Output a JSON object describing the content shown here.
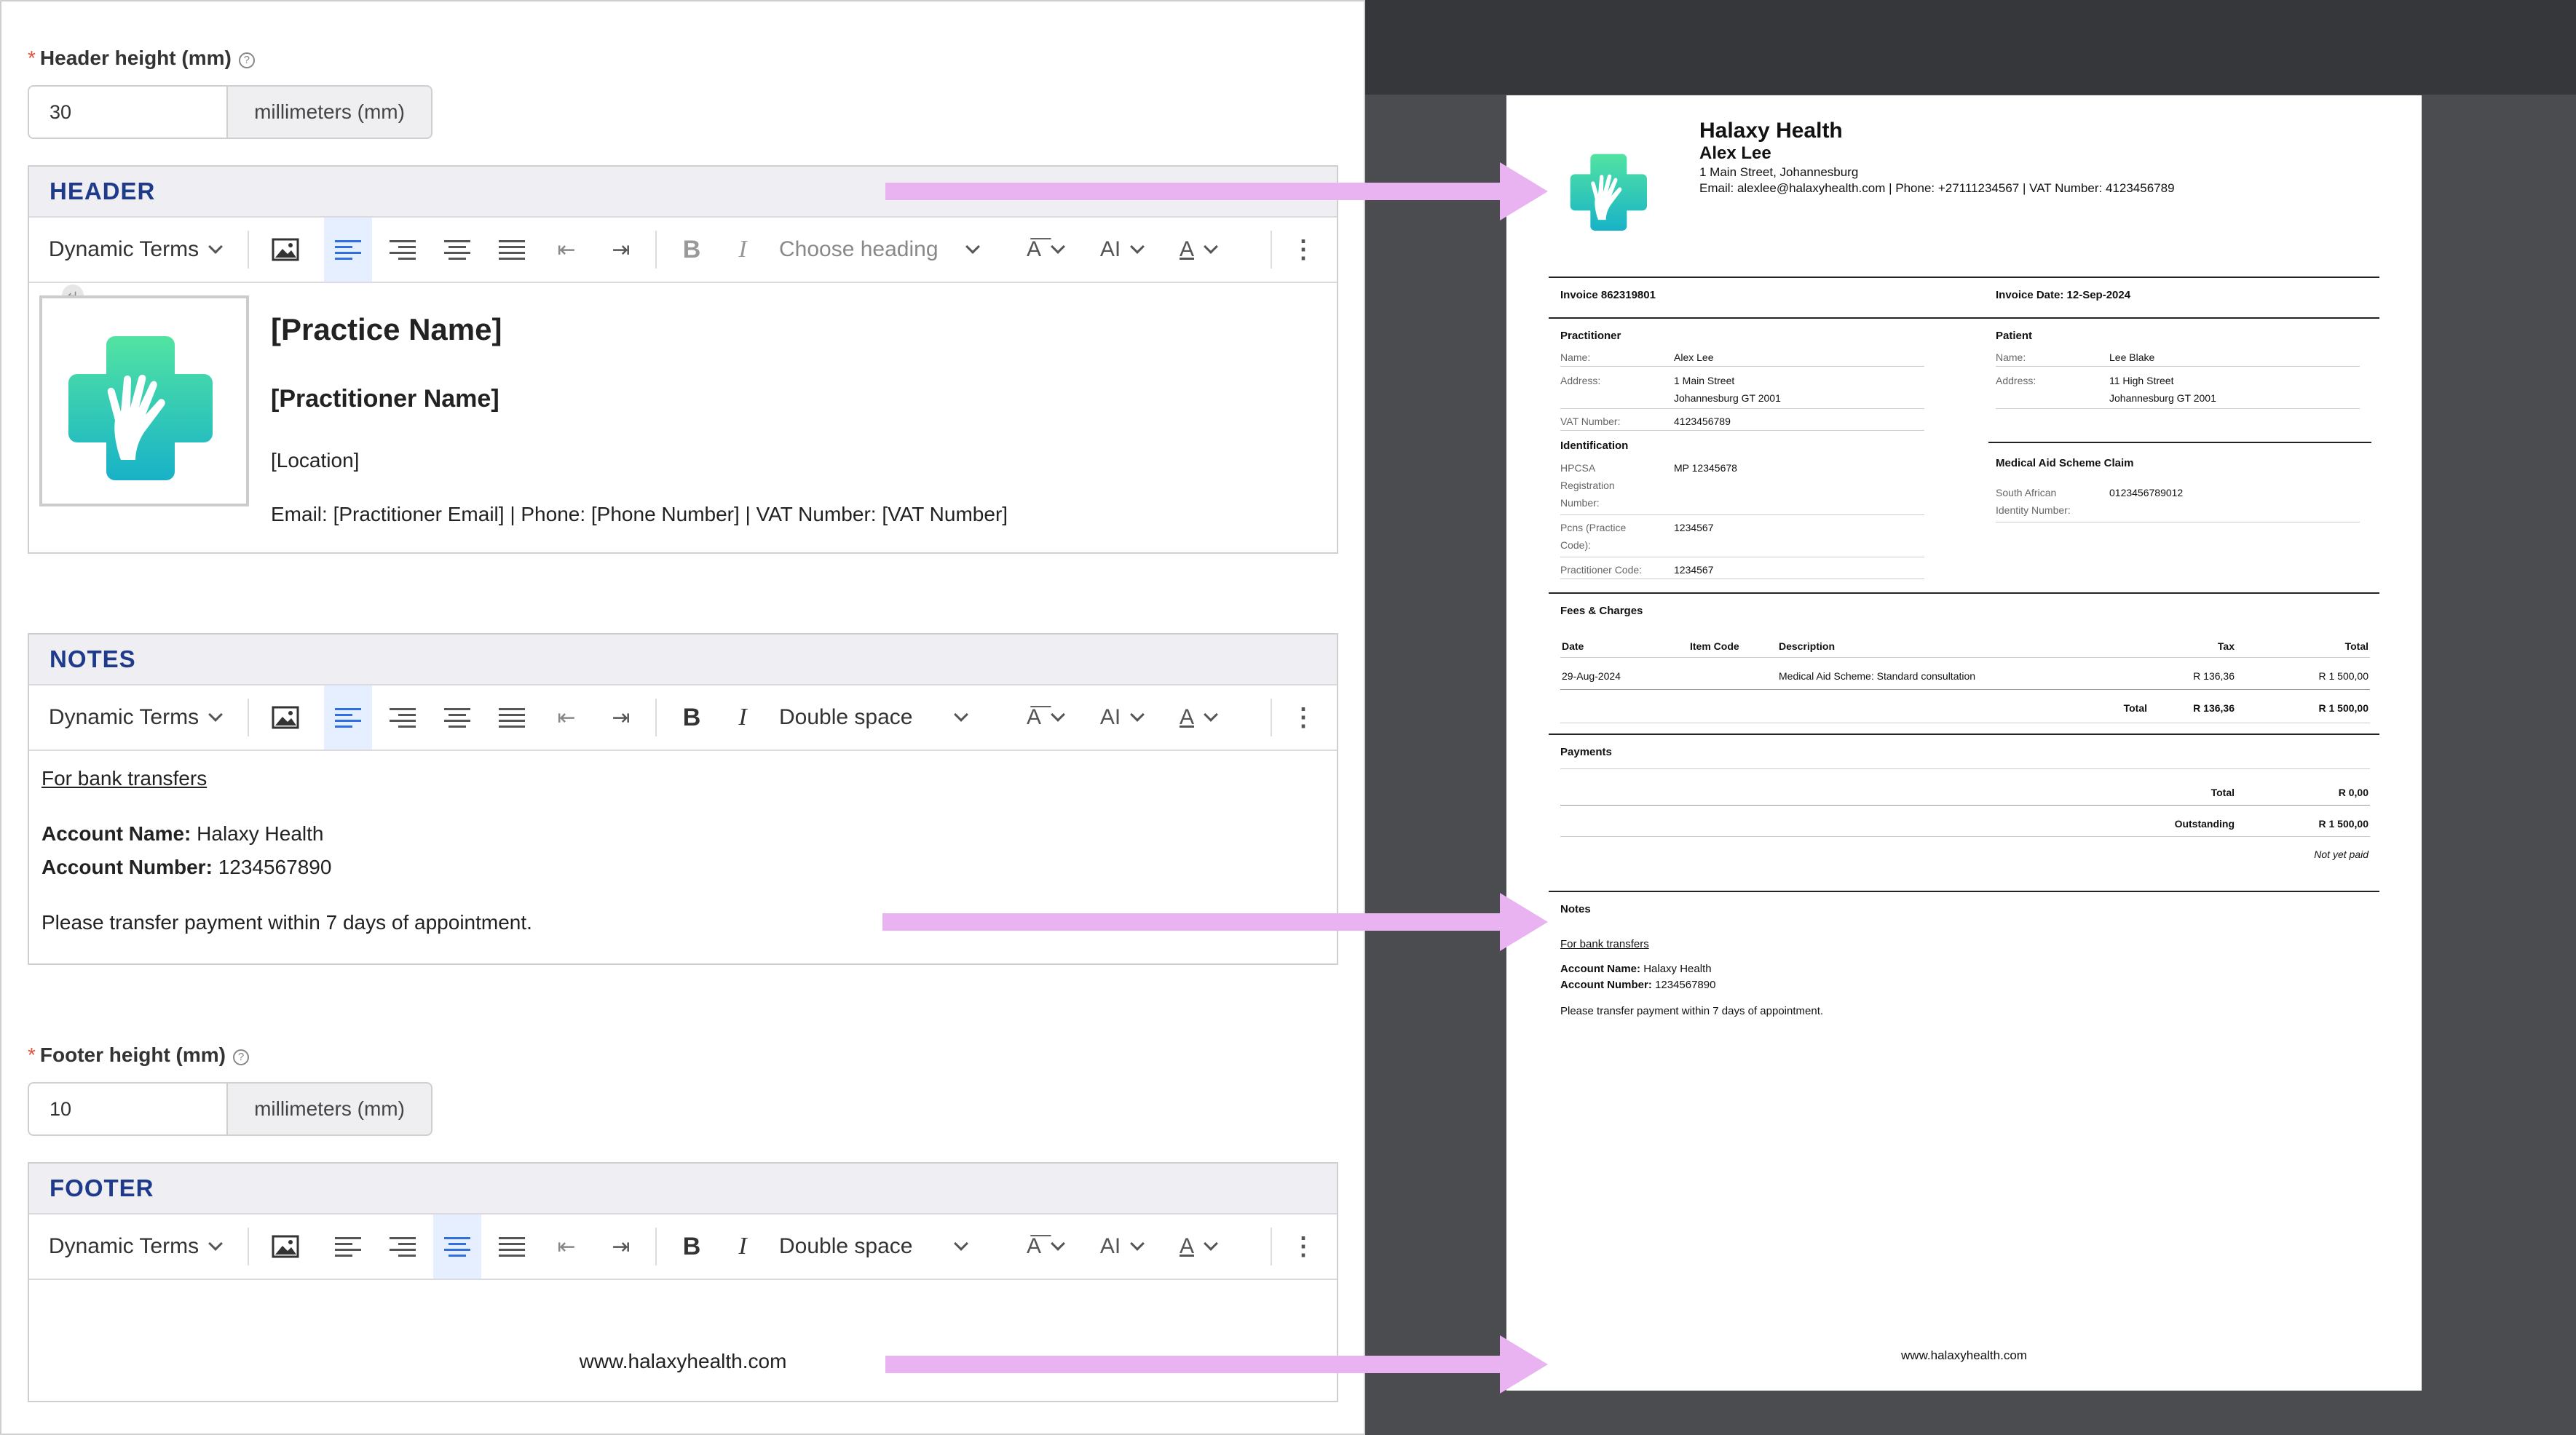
{
  "editor": {
    "header_height": {
      "label": "Header height (mm)",
      "value": "30",
      "unit": "millimeters (mm)"
    },
    "footer_height": {
      "label": "Footer height (mm)",
      "value": "10",
      "unit": "millimeters (mm)"
    },
    "toolbar": {
      "dynamic_terms": "Dynamic Terms",
      "choose_heading": "Choose heading",
      "double_space": "Double space"
    },
    "header": {
      "title": "HEADER",
      "practice_name": "[Practice Name]",
      "practitioner_name": "[Practitioner Name]",
      "location": "[Location]",
      "contact_line": "Email: [Practitioner Email] | Phone: [Phone Number] | VAT Number: [VAT Number]"
    },
    "notes": {
      "title": "NOTES",
      "bank_heading": "For bank transfers",
      "account_name_label": "Account Name:",
      "account_name": "Halaxy Health",
      "account_number_label": "Account Number:",
      "account_number": "1234567890",
      "instruction": "Please transfer payment within 7 days of appointment."
    },
    "footer": {
      "title": "FOOTER",
      "url": "www.halaxyhealth.com"
    }
  },
  "invoice": {
    "practice_name": "Halaxy Health",
    "practitioner": "Alex Lee",
    "address": "1 Main Street, Johannesburg",
    "contact": "Email: alexlee@halaxyhealth.com | Phone: +27111234567 | VAT Number: 4123456789",
    "invoice_no": "Invoice 862319801",
    "invoice_date": "Invoice Date: 12-Sep-2024",
    "practitioner_section": {
      "title": "Practitioner",
      "name_label": "Name:",
      "name": "Alex Lee",
      "address_label": "Address:",
      "address1": "1 Main Street",
      "address2": "Johannesburg GT 2001",
      "vat_label": "VAT Number:",
      "vat": "4123456789"
    },
    "identification": {
      "title": "Identification",
      "hpcsa_label1": "HPCSA",
      "hpcsa_label2": "Registration",
      "hpcsa_label3": "Number:",
      "hpcsa": "MP 12345678",
      "pcns_label1": "Pcns (Practice",
      "pcns_label2": "Code):",
      "pcns": "1234567",
      "pc_label": "Practitioner Code:",
      "pc": "1234567"
    },
    "patient": {
      "title": "Patient",
      "name_label": "Name:",
      "name": "Lee Blake",
      "address_label": "Address:",
      "address1": "11 High Street",
      "address2": "Johannesburg GT 2001"
    },
    "medical_aid": {
      "title": "Medical Aid Scheme Claim",
      "id_label1": "South African",
      "id_label2": "Identity Number:",
      "id": "0123456789012"
    },
    "fees": {
      "title": "Fees & Charges",
      "headers": {
        "date": "Date",
        "item_code": "Item Code",
        "description": "Description",
        "tax": "Tax",
        "total": "Total"
      },
      "row": {
        "date": "29-Aug-2024",
        "description": "Medical Aid Scheme: Standard consultation",
        "tax": "R 136,36",
        "total": "R 1 500,00"
      },
      "total_label": "Total",
      "total_tax": "R 136,36",
      "total_amount": "R 1 500,00"
    },
    "payments": {
      "title": "Payments",
      "total_label": "Total",
      "total": "R 0,00",
      "outstanding_label": "Outstanding",
      "outstanding": "R 1 500,00",
      "status": "Not yet paid"
    },
    "notes": {
      "title": "Notes",
      "bank_heading": "For bank transfers",
      "account_name_label": "Account Name:",
      "account_name": "Halaxy Health",
      "account_number_label": "Account Number:",
      "account_number": "1234567890",
      "instruction": "Please transfer payment within 7 days of appointment."
    },
    "footer_url": "www.halaxyhealth.com"
  },
  "colors": {
    "accent_title": "#1e3a8a",
    "arrow": "#e9b3f2",
    "logo_top": "#4fe0a6",
    "logo_bottom": "#1bb4c4",
    "active_tool": "#e6efff"
  }
}
